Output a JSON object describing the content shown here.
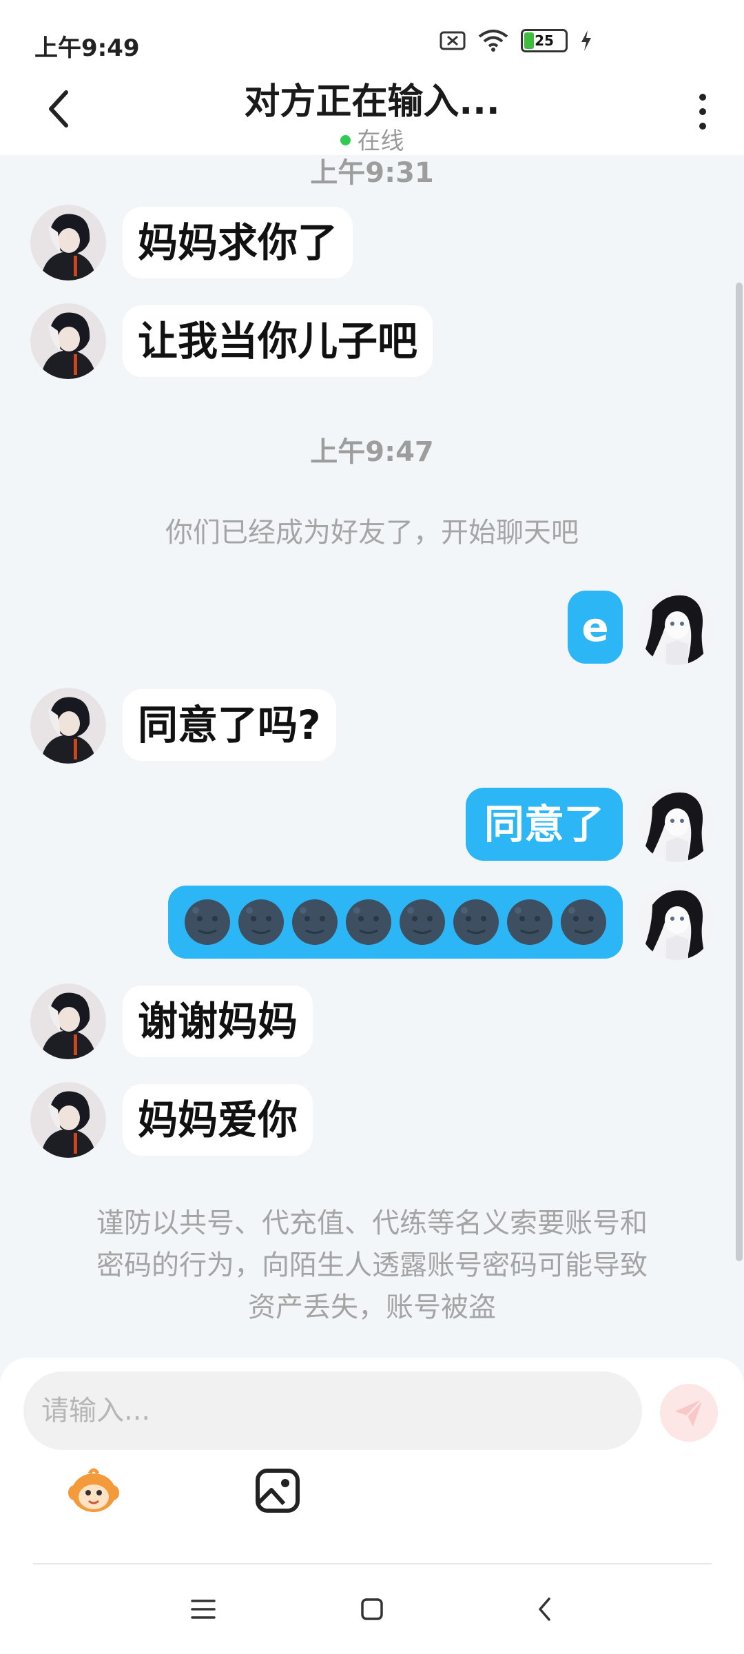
{
  "status_bar": {
    "time": "上午9:49",
    "battery": "25"
  },
  "header": {
    "title": "对方正在输入...",
    "presence": "在线"
  },
  "messages": [
    {
      "type": "timestamp",
      "text": "上午9:31"
    },
    {
      "type": "left",
      "text": "妈妈求你了"
    },
    {
      "type": "left",
      "text": "让我当你儿子吧"
    },
    {
      "type": "timestamp",
      "text": "上午9:47"
    },
    {
      "type": "system",
      "text": "你们已经成为好友了，开始聊天吧"
    },
    {
      "type": "right",
      "text": "e"
    },
    {
      "type": "left",
      "text": "同意了吗?"
    },
    {
      "type": "right",
      "text": "同意了"
    },
    {
      "type": "right",
      "text": "🌚🌚🌚🌚🌚🌚🌚🌚"
    },
    {
      "type": "left",
      "text": "谢谢妈妈"
    },
    {
      "type": "left",
      "text": "妈妈爱你"
    }
  ],
  "warning": {
    "line1": "谨防以共号、代充值、代练等名义索要账号和",
    "line2": "密码的行为，向陌生人透露账号密码可能导致",
    "line3": "资产丢失，账号被盗"
  },
  "composer": {
    "placeholder": "请输入..."
  },
  "icons": {
    "back": "chevron-left-icon",
    "menu": "more-vertical-icon",
    "send": "send-icon",
    "sticker": "monkey-sticker-icon",
    "image": "image-icon",
    "nav": [
      "menu-lines-icon",
      "home-square-icon",
      "back-chevron-icon"
    ]
  },
  "colors": {
    "accent": "#2db6f5",
    "background": "#f3f6f9",
    "online": "#2ecc55",
    "send_disabled": "#fde6e6"
  }
}
